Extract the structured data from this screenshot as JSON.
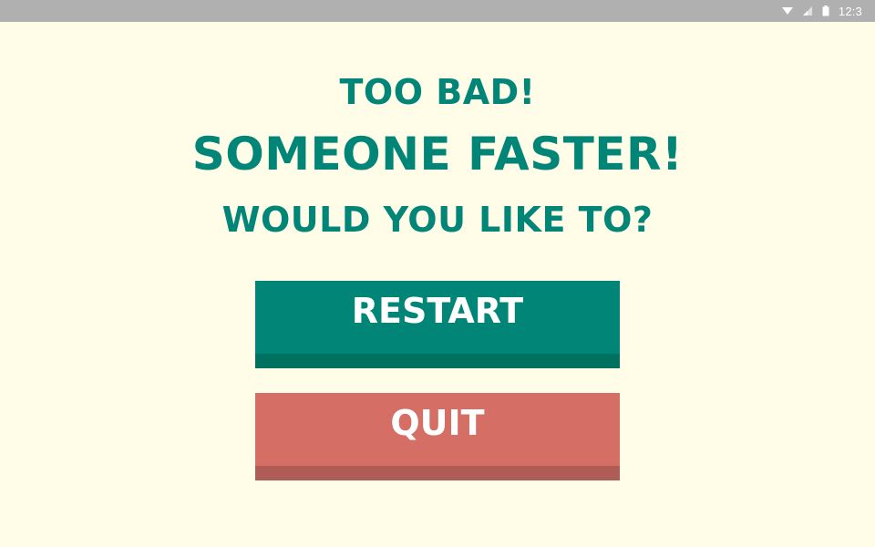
{
  "status_bar": {
    "time": "12:3",
    "icons": [
      "wifi-icon",
      "signal-icon",
      "battery-icon"
    ],
    "color": "#b0b0b0"
  },
  "dialog": {
    "line1": "Too bad!",
    "line2": "Someone faster!",
    "line3": "Would you like to?"
  },
  "buttons": {
    "restart_label": "Restart",
    "quit_label": "Quit"
  },
  "colors": {
    "background": "#fffde8",
    "accent": "#008577",
    "restart_shadow": "#00705f",
    "quit": "#d56f66",
    "quit_shadow": "#ae5c55"
  }
}
